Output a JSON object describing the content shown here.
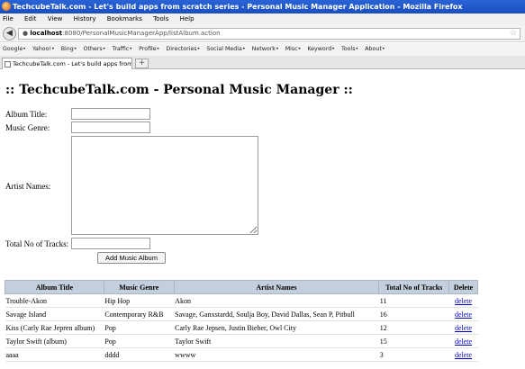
{
  "window": {
    "title": "TechcubeTalk.com - Let's build apps from scratch series - Personal Music Manager Application - Mozilla Firefox"
  },
  "menu": [
    "File",
    "Edit",
    "View",
    "History",
    "Bookmarks",
    "Tools",
    "Help"
  ],
  "nav": {
    "url_host": "localhost",
    "url_rest": ":8080/PersonalMusicManagerApp/listAlbum.action"
  },
  "bookmarks": [
    "Google•",
    "Yahoo!•",
    "Bing•",
    "Others•",
    "Traffic•",
    "Profile•",
    "Directories•",
    "Social Media•",
    "Network•",
    "Misc•",
    "Keyword•",
    "Tools•",
    "About•"
  ],
  "tab": {
    "label": "TechcubeTalk.com - Let's build apps from scr...",
    "new_tab": "+"
  },
  "page": {
    "title": ":: TechcubeTalk.com - Personal Music Manager ::"
  },
  "form": {
    "album_title_label": "Album Title:",
    "album_title_value": "",
    "music_genre_label": "Music Genre:",
    "music_genre_value": "",
    "artist_names_label": "Artist Names:",
    "artist_names_value": "",
    "total_tracks_label": "Total No of Tracks:",
    "total_tracks_value": "",
    "submit_label": "Add Music Album"
  },
  "table": {
    "headers": [
      "Album Title",
      "Music Genre",
      "Artist Names",
      "Total No of Tracks",
      "Delete"
    ],
    "rows": [
      [
        "Trouble-Akon",
        "Hip Hop",
        "Akon",
        "11",
        "delete"
      ],
      [
        "Savage Island",
        "Contemporary R&B",
        "Savage, Ganxstardd, Soulja Boy, David Dallas, Sean P, Pitbull",
        "16",
        "delete"
      ],
      [
        "Kiss (Carly Rae Jepren album)",
        "Pop",
        "Carly Rae Jepsen, Justin Bieber, Owl City",
        "12",
        "delete"
      ],
      [
        "Taylor Swift (album)",
        "Pop",
        "Taylor Swift",
        "15",
        "delete"
      ],
      [
        "aaaa",
        "dddd",
        "wwww",
        "3",
        "delete"
      ]
    ]
  }
}
